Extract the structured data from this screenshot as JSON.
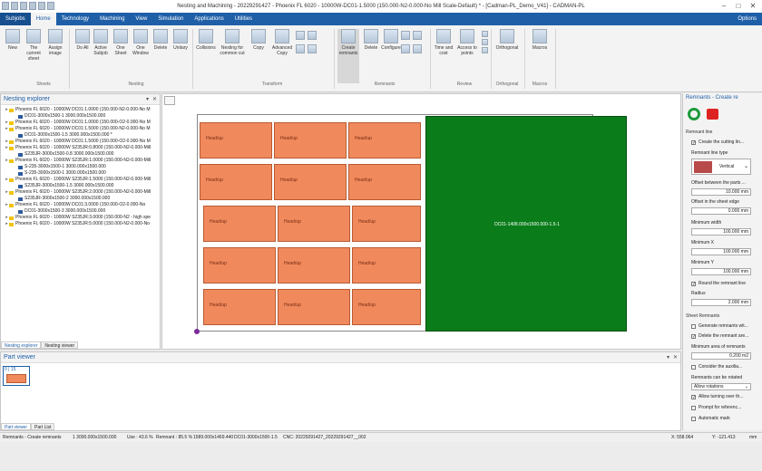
{
  "window": {
    "title": "Nesting and Machining - 20229291427 - Phoenix FL 6020 - 10000W-DC01-1.5000 (150.000-N2-0.000-No Mill Scale-Default) * - [Cadman-PL_Demo_V41] - CADMAN-PL"
  },
  "menu": {
    "tabs": [
      "Subjobs",
      "Home",
      "Technology",
      "Machining",
      "View",
      "Simulation",
      "Applications",
      "Utilities"
    ],
    "options": "Options"
  },
  "ribbon": {
    "buttons": [
      "New",
      "The current sheet",
      "Assign image",
      "Do All",
      "Active Subjob",
      "One Sheet",
      "One Window",
      "Delete",
      "Unitary",
      "Collisions",
      "Nesting for common cut",
      "Copy",
      "Advanced Copy",
      "Create remnants",
      "Delete",
      "Configure",
      "Time and cost",
      "Access to points",
      "Orthogonal",
      "Macros"
    ],
    "groups": [
      "Sheets",
      "Nesting",
      "Transform",
      "Remnants",
      "Review",
      "Orthogonal",
      "Macros"
    ]
  },
  "nesting_explorer": {
    "title": "Nesting explorer",
    "rows": [
      {
        "kind": "folder",
        "text": "Phoenix FL 6020 - 10000W DC01:1.0000 (150.000-N2-0.000-No M"
      },
      {
        "kind": "sheet",
        "text": "DC01-3000x1500-1 3000.000x1500.000"
      },
      {
        "kind": "folder",
        "text": "Phoenix FL 6020 - 10000W DC01:1.0000 (150.000-O2-0.000-No M"
      },
      {
        "kind": "folder",
        "text": "Phoenix FL 6020 - 10000W DC01:1.5000 (150.000-N2-0.000-No M"
      },
      {
        "kind": "sheet",
        "text": "DC01-3000x1500-1.5 3000.000x1500.000 *"
      },
      {
        "kind": "folder",
        "text": "Phoenix FL 6020 - 10000W DC01:1.5000 (150.000-O2-0.000-No M"
      },
      {
        "kind": "folder",
        "text": "Phoenix FL 6020 - 10000W S235JR:0.8000 (150.000-N2-0.000-Mill"
      },
      {
        "kind": "sheet",
        "text": "S235JR-3000x1500-0.8 3000.000x1500.000"
      },
      {
        "kind": "folder",
        "text": "Phoenix FL 6020 - 10000W S235JR:1.0000 (150.000-N2-0.000-Mill"
      },
      {
        "kind": "sheet",
        "text": "S-235-3000x1500-1 3000.000x1500.000"
      },
      {
        "kind": "sheet",
        "text": "S-235-3000x1500-1 3000.000x1500.000"
      },
      {
        "kind": "folder",
        "text": "Phoenix FL 6020 - 10000W S235JR:1.5000 (150.000-N2-0.000-Mill"
      },
      {
        "kind": "sheet",
        "text": "S235JR-3000x1500-1.5 3000.000x1500.000"
      },
      {
        "kind": "folder",
        "text": "Phoenix FL 6020 - 10000W S235JR:2.0000 (150.000-N2-0.000-Mill"
      },
      {
        "kind": "sheet",
        "text": "S235JR-3000x1500-2 3000.000x1500.000"
      },
      {
        "kind": "folder",
        "text": "Phoenix FL 6020 - 10000W DC01:3.0000 (150.000-O2-0.000-No"
      },
      {
        "kind": "sheet",
        "text": "DC01-3000x1500-3 3000.000x1500.000"
      },
      {
        "kind": "folder",
        "text": "Phoenix FL 6020 - 10000W S235JR:3.0000 (150.000-N2 - high spe"
      },
      {
        "kind": "folder",
        "text": "Phoenix FL 6020 - 10000W S235JR:5.0000 (150.000-N2-0.000-No"
      }
    ],
    "tabs": [
      "Nesting explorer",
      "Nesting viewer"
    ]
  },
  "part_viewer": {
    "title": "Part viewer",
    "count": "0 | 15",
    "tabs": [
      "Part viewer",
      "Part List"
    ]
  },
  "canvas": {
    "part_label": "Head/up",
    "remnant_label": "DC01-1408.000x1500.000-1.5-1"
  },
  "remnants_panel": {
    "title": "Remnants - Create re",
    "section_line": "Remnant line",
    "create_cutting": "Create the cutting lin...",
    "line_type_label": "Remnant line type",
    "line_type_value": "Vertical",
    "offset_parts_label": "Offset between the parts ...",
    "offset_parts_value": "10.000 mm",
    "offset_edge_label": "Offset in the sheet edge",
    "offset_edge_value": "0.000 mm",
    "min_width_label": "Minimum width",
    "min_width_value": "100.000 mm",
    "min_x_label": "Minimum X",
    "min_x_value": "100.000 mm",
    "min_y_label": "Minimum Y",
    "min_y_value": "100.000 mm",
    "round_label": "Round the remnant line",
    "radius_label": "Radius",
    "radius_value": "2.000 mm",
    "section_sheet": "Sheet Remnants",
    "generate": "Generate remnants wit...",
    "delete_area": "Delete the remnant are...",
    "min_area_label": "Minimum area of remnants",
    "min_area_value": "0.200 m2",
    "consider": "Consider the auxilia...",
    "rotated_label": "Remnants can be rotated",
    "rotated_value": "Allow rotations",
    "allow_turn": "Allow turning over th...",
    "prompt_ref": "Prompt for referenc...",
    "auto_mark": "Automatic mark"
  },
  "status": {
    "mode": "Remnants - Create remnants",
    "sheet": "1  3000.000x1500.000",
    "use": "Use : 43.6 %",
    "remnant": "Remnant : 85.5 %",
    "remnant_size": "1589.000x1469.440",
    "material": "DC01-3000x1500-1.5",
    "cnc": "CNC: 20229291427_20229291427__002",
    "x": "X: 558.064",
    "y": "Y: -121.413",
    "unit": "mm"
  }
}
